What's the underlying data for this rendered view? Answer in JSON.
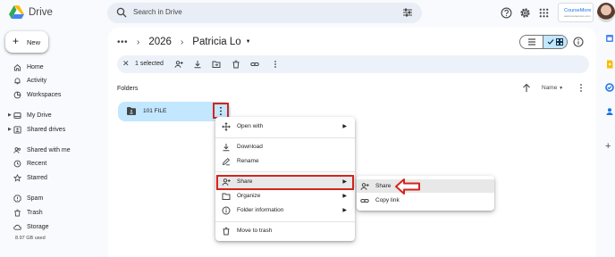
{
  "app": {
    "name": "Drive"
  },
  "search": {
    "placeholder": "Search in Drive"
  },
  "brand": {
    "name": "CourseMore",
    "tagline": "www.coursemore.com"
  },
  "colors": {
    "accent": "#0b57d0",
    "selection": "#c2e7ff",
    "highlight_box": "#d5241c"
  },
  "sidebar": {
    "new_label": "New",
    "items": [
      {
        "label": "Home",
        "icon": "home-icon"
      },
      {
        "label": "Activity",
        "icon": "bell-icon"
      },
      {
        "label": "Workspaces",
        "icon": "workspaces-icon"
      },
      {
        "label": "My Drive",
        "icon": "my-drive-icon"
      },
      {
        "label": "Shared drives",
        "icon": "shared-drives-icon"
      },
      {
        "label": "Shared with me",
        "icon": "shared-with-me-icon"
      },
      {
        "label": "Recent",
        "icon": "clock-icon"
      },
      {
        "label": "Starred",
        "icon": "star-icon"
      },
      {
        "label": "Spam",
        "icon": "spam-icon"
      },
      {
        "label": "Trash",
        "icon": "trash-icon"
      },
      {
        "label": "Storage",
        "icon": "cloud-icon"
      }
    ],
    "storage_used": "8.97 GB used"
  },
  "breadcrumb": {
    "more": "•••",
    "items": [
      "2026",
      "Patricia Lo"
    ]
  },
  "selection_bar": {
    "count_label": "1 selected"
  },
  "folders": {
    "section_label": "Folders",
    "sort_label": "Name",
    "items": [
      {
        "name": "101 FILE"
      }
    ]
  },
  "context_menu": {
    "items": [
      {
        "label": "Open with",
        "icon": "open-with-icon",
        "submenu": true
      },
      {
        "label": "Download",
        "icon": "download-icon",
        "submenu": false
      },
      {
        "label": "Rename",
        "icon": "rename-icon",
        "submenu": false
      },
      {
        "label": "Share",
        "icon": "share-icon",
        "submenu": true
      },
      {
        "label": "Organize",
        "icon": "organize-icon",
        "submenu": true
      },
      {
        "label": "Folder information",
        "icon": "info-icon",
        "submenu": true
      },
      {
        "label": "Move to trash",
        "icon": "trash-icon",
        "submenu": false
      }
    ]
  },
  "share_submenu": {
    "items": [
      {
        "label": "Share",
        "icon": "person-add-icon"
      },
      {
        "label": "Copy link",
        "icon": "link-icon"
      }
    ]
  }
}
